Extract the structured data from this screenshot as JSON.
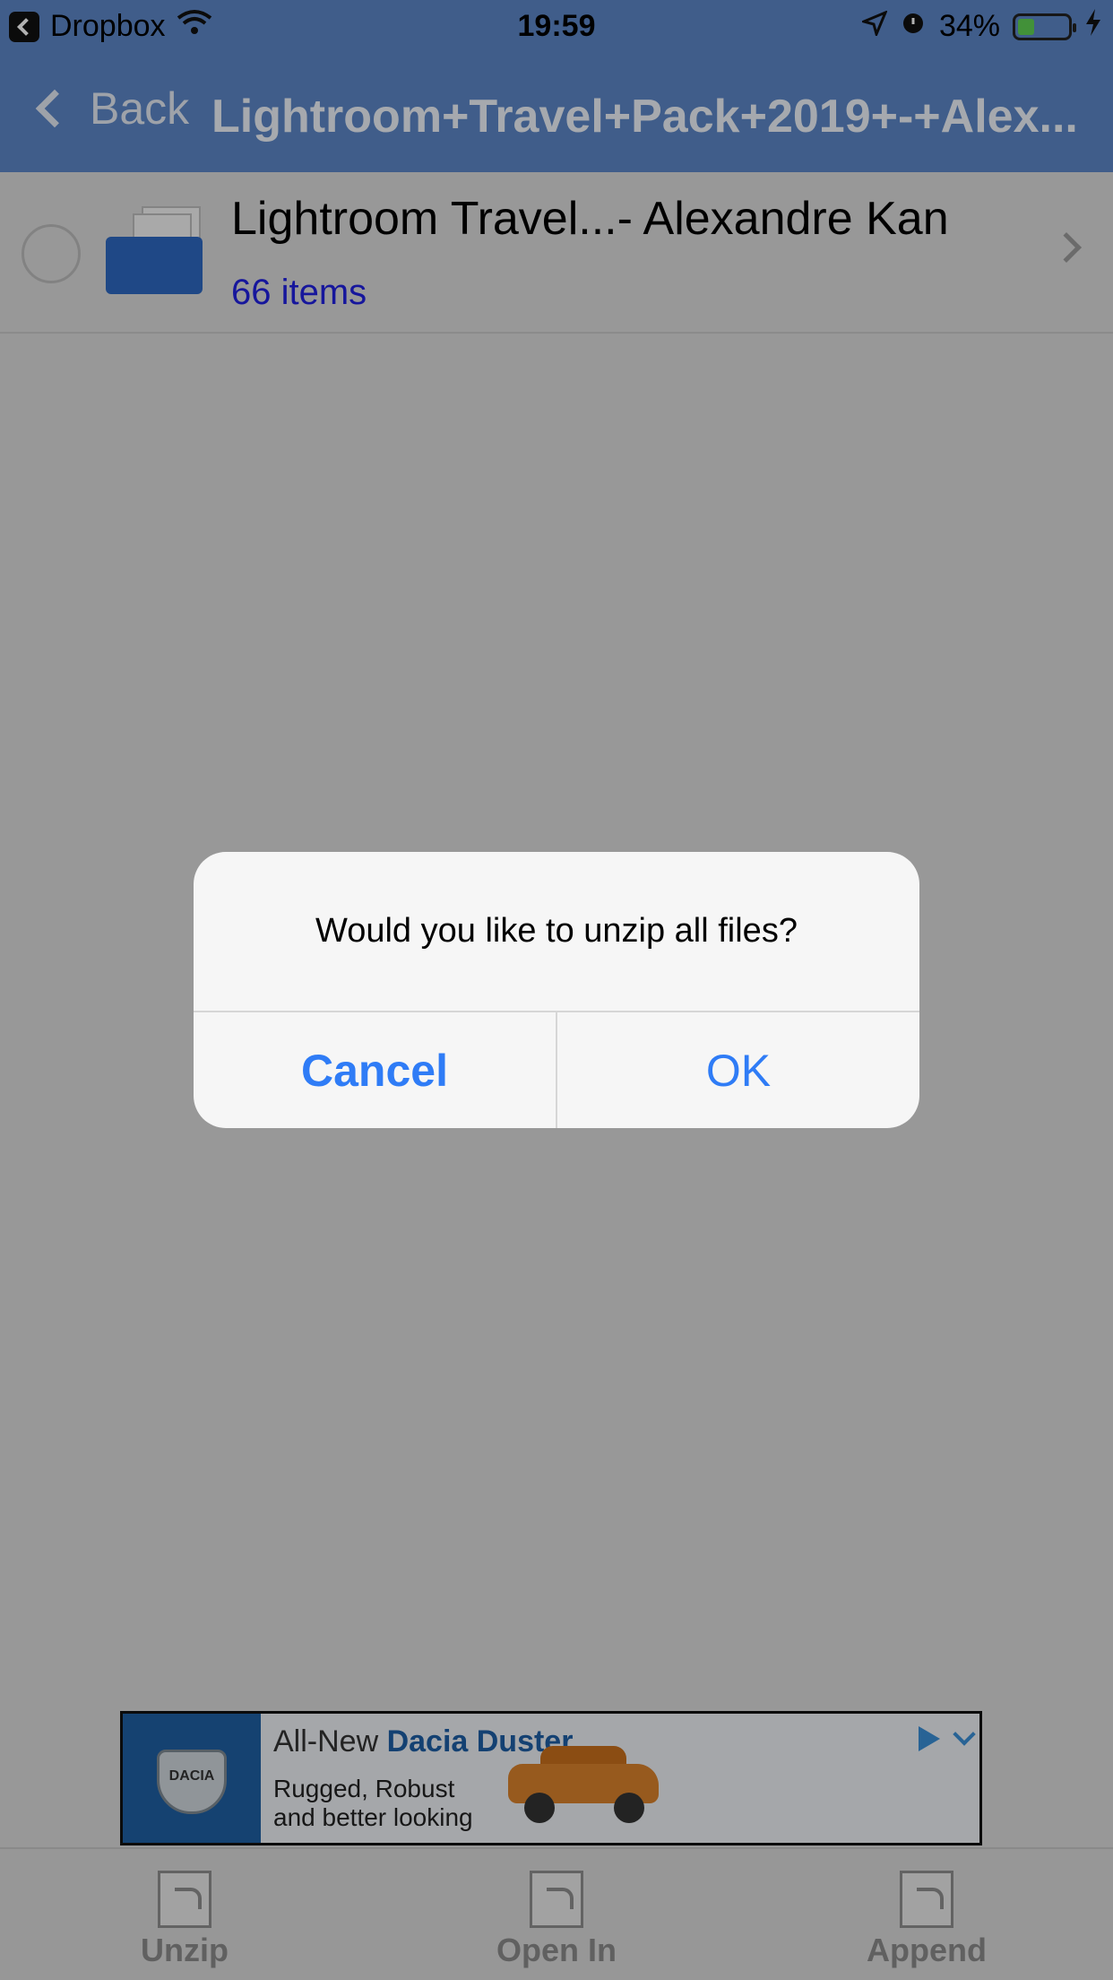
{
  "status_bar": {
    "back_app": "Dropbox",
    "time": "19:59",
    "battery": "34%",
    "battery_level": 0.34
  },
  "nav": {
    "back_label": "Back",
    "title": "Lightroom+Travel+Pack+2019+-+Alex..."
  },
  "list": {
    "items": [
      {
        "name": "Lightroom Travel...- Alexandre Kan",
        "count": "66 items"
      }
    ]
  },
  "dialog": {
    "message": "Would you like to unzip all files?",
    "cancel_label": "Cancel",
    "ok_label": "OK"
  },
  "ad": {
    "line1_prefix": "All-New ",
    "line1_brand": "Dacia Duster",
    "line2": "Rugged, Robust",
    "line3": "and better looking",
    "logo_text": "DACIA"
  },
  "toolbar": {
    "unzip_label": "Unzip",
    "open_in_label": "Open In",
    "append_label": "Append"
  },
  "colors": {
    "nav_bar": "#5c86c6",
    "dialog_button": "#2f7cf6",
    "item_count": "#2020e0"
  }
}
